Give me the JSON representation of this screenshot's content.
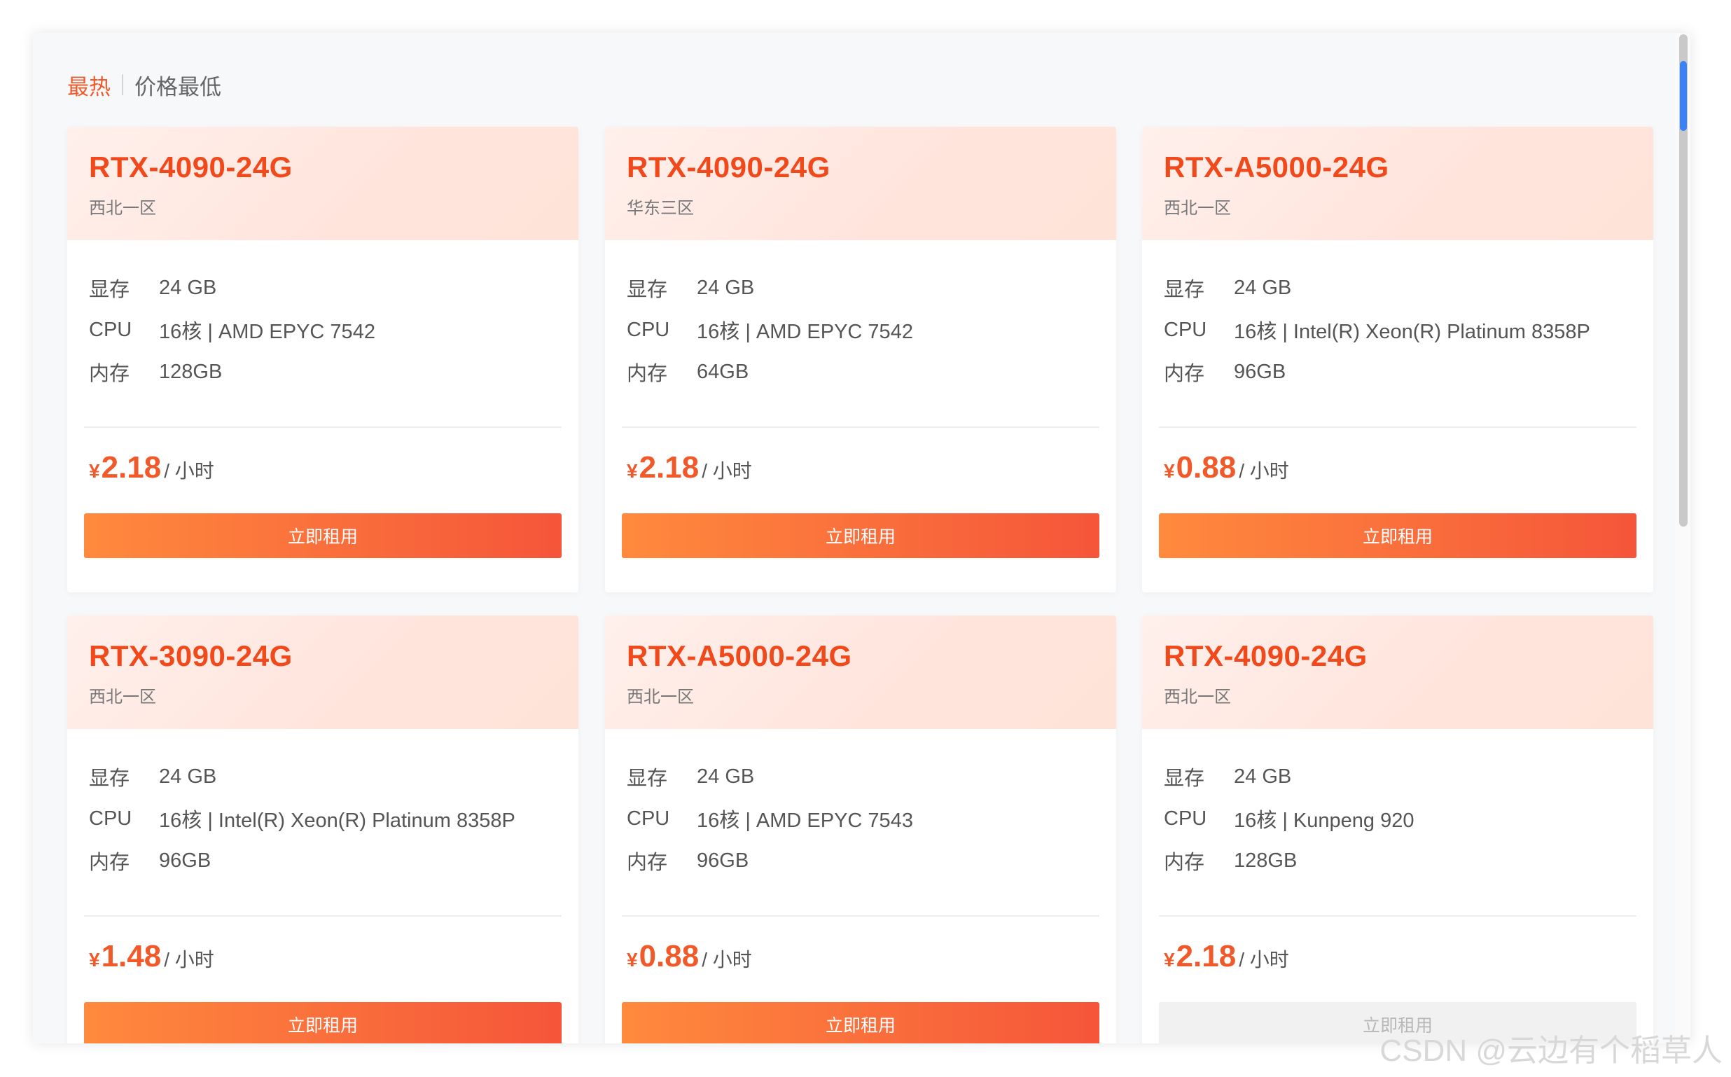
{
  "sort": {
    "tabs": [
      {
        "label": "最热",
        "active": true
      },
      {
        "label": "价格最低",
        "active": false
      }
    ]
  },
  "spec_labels": {
    "vram": "显存",
    "cpu": "CPU",
    "ram": "内存"
  },
  "currency": "¥",
  "unit": "/ 小时",
  "rent_label": "立即租用",
  "cards": [
    {
      "title": "RTX-4090-24G",
      "region": "西北一区",
      "vram": "24 GB",
      "cpu": "16核 | AMD EPYC 7542",
      "ram": "128GB",
      "price": "2.18",
      "available": true
    },
    {
      "title": "RTX-4090-24G",
      "region": "华东三区",
      "vram": "24 GB",
      "cpu": "16核 | AMD EPYC 7542",
      "ram": "64GB",
      "price": "2.18",
      "available": true
    },
    {
      "title": "RTX-A5000-24G",
      "region": "西北一区",
      "vram": "24 GB",
      "cpu": "16核 | Intel(R) Xeon(R) Platinum 8358P",
      "ram": "96GB",
      "price": "0.88",
      "available": true
    },
    {
      "title": "RTX-3090-24G",
      "region": "西北一区",
      "vram": "24 GB",
      "cpu": "16核 | Intel(R) Xeon(R) Platinum 8358P",
      "ram": "96GB",
      "price": "1.48",
      "available": true
    },
    {
      "title": "RTX-A5000-24G",
      "region": "西北一区",
      "vram": "24 GB",
      "cpu": "16核 | AMD EPYC 7543",
      "ram": "96GB",
      "price": "0.88",
      "available": true
    },
    {
      "title": "RTX-4090-24G",
      "region": "西北一区",
      "vram": "24 GB",
      "cpu": "16核 | Kunpeng 920",
      "ram": "128GB",
      "price": "2.18",
      "available": false
    }
  ],
  "watermark": "CSDN @云边有个稻草人",
  "colors": {
    "accent": "#f05a2a",
    "title": "#f04a1c",
    "button_start": "#ff8a3d",
    "button_end": "#f5553a"
  }
}
